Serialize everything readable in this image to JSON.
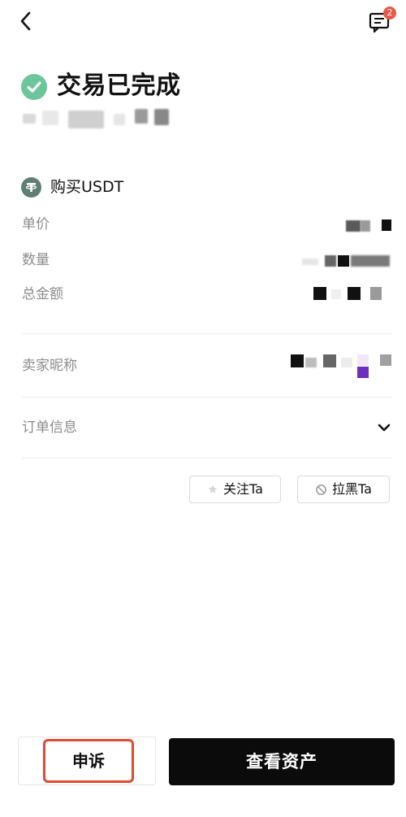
{
  "header": {
    "back_icon": "chevron-left-icon",
    "message_icon": "message-icon",
    "message_badge": "2"
  },
  "status": {
    "title": "交易已完成",
    "icon": "check-circle-icon",
    "icon_color": "#6cc59b"
  },
  "order": {
    "product_icon": "tether-icon",
    "product": "购买USDT",
    "rows": [
      {
        "label": "单价"
      },
      {
        "label": "数量"
      },
      {
        "label": "总金额"
      }
    ]
  },
  "seller": {
    "label": "卖家昵称"
  },
  "order_info": {
    "label": "订单信息",
    "icon": "chevron-down-icon"
  },
  "actions": {
    "follow_label": "关注Ta",
    "follow_icon": "star-icon",
    "block_label": "拉黑Ta",
    "block_icon": "block-icon"
  },
  "footer": {
    "appeal_label": "申诉",
    "assets_label": "查看资产",
    "appeal_highlight_color": "#de4a32",
    "primary_color": "#0b0b0b"
  }
}
